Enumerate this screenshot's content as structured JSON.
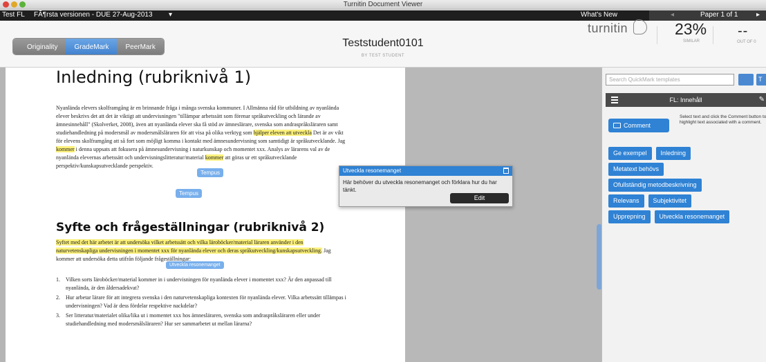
{
  "window": {
    "title": "Turnitin Document Viewer"
  },
  "menubar": {
    "class_name": "Test FL",
    "assignment": "FÃ¶rsta versionen - DUE 27-Aug-2013",
    "assignment_chevron": "▾",
    "whats_new": "What's New",
    "prev_arrow": "◂",
    "paper_label": "Paper 1 of 1",
    "next_arrow": "▸"
  },
  "header": {
    "modes": [
      {
        "label": "Originality",
        "active": false
      },
      {
        "label": "GradeMark",
        "active": true
      },
      {
        "label": "PeerMark",
        "active": false
      }
    ],
    "student_name": "Teststudent0101",
    "byline": "BY TEST STUDENT",
    "logo_text": "turnitin",
    "similarity": "23%",
    "similarity_label": "SIMILAR",
    "grade": "--",
    "grade_label": "OUT OF 0"
  },
  "document": {
    "heading1": "Inledning (rubriknivå 1)",
    "paragraph1": [
      {
        "text": "Nyanlända elevers skolframgång är en brinnande fråga i många svenska kommuner. I Allmänna råd för utbildning av nyanlända elever beskrivs det att det är viktigt att undervisningen \"tillämpar arbetssätt som förenar språkutveckling och lärande av ämnesinnehåll\" (Skolverket, 2008), även att nyanlända elever ska få stöd av ämneslärare, svenska som andraspråksläraren samt studiehandledning på modersmål av modersmålsläraren för att visa på olika verktyg som ",
        "hl": false
      },
      {
        "text": "hjälper eleven att utveckla",
        "hl": true
      },
      {
        "text": " Det är av vikt för elevens skolframgång att så fort som möjligt komma i kontakt med ämnesundervisning som samtidigt är språkutvecklande. Jag ",
        "hl": false
      },
      {
        "text": "kommer",
        "hl": true
      },
      {
        "text": " i denna uppsats att fokusera på ämnesundervisning i naturkunskap och momentet xxx. Analys av lärarens val av de nyanlända elevernas arbetssätt och undervisningslitteratur/material ",
        "hl": false
      },
      {
        "text": "kommer",
        "hl": true
      },
      {
        "text": " att göras ur ett språkutvecklande perspektiv/kunskapsutvecklande perspektiv.",
        "hl": false
      }
    ],
    "bubble_tempus_1": "Tempus",
    "bubble_tempus_2": "Tempus",
    "heading2": "Syfte och frågeställningar (rubriknivå 2)",
    "paragraph2": [
      {
        "text": "Syftet med det här arbetet är att undersöka vilket arbetssätt och vilka läroböcker/material läraren använder i den naturvetenskapliga undervisningen i momentet xxx för nyanlända elever och deras språkutveckling/kunskapsutveckling.",
        "hl": true
      },
      {
        "text": " Jag kommer att undersöka detta utifrån följande frågeställningar:",
        "hl": false
      }
    ],
    "bubble_reasoning": "Utveckla resonemanget",
    "questions": [
      {
        "num": "1.",
        "text": "Vilken sorts läroböcker/material kommer in i undervisningen för nyanlända elever i momentet xxx? Är den anpassad till nyanlända, är den åldersadekvat?"
      },
      {
        "num": "2.",
        "text": "Hur arbetar lärare för att integrera svenska i den naturvetenskapliga kontexten för nyanlända elever. Vilka arbetssätt tillämpas i undervisningen? Vad är dess fördelar respektive nackdelar?"
      },
      {
        "num": "3.",
        "text": "Ser litteratur/materialet olika/lika ut i momentet xxx hos ämnesläraren, svenska som andraspråksläraren eller under studiehandledning med modersmålsläraren? Hur ser sammarbetet ut mellan lärarna?"
      }
    ]
  },
  "popup": {
    "title": "Utveckla resonemanget",
    "body": "Här behöver du utveckla resonemanget och förklara hur du har tänkt.",
    "edit_label": "Edit"
  },
  "quickmark": {
    "search_placeholder": "Search QuickMark templates",
    "set_name": "FL: Innehåll",
    "comment_label": "Comment",
    "hint": "Select text and click the Comment button to highlight text associated with a comment.",
    "tag_rows": [
      [
        "Ge exempel",
        "Inledning"
      ],
      [
        "Metatext behövs"
      ],
      [
        "Ofullständig metodbeskrivning"
      ],
      [
        "Relevans",
        "Subjektivitet"
      ],
      [
        "Upprepning",
        "Utveckla resonemanget"
      ]
    ]
  },
  "colors": {
    "accent": "#2f82d4",
    "highlight": "#fbf07a",
    "menubar": "#1f1f1f"
  }
}
